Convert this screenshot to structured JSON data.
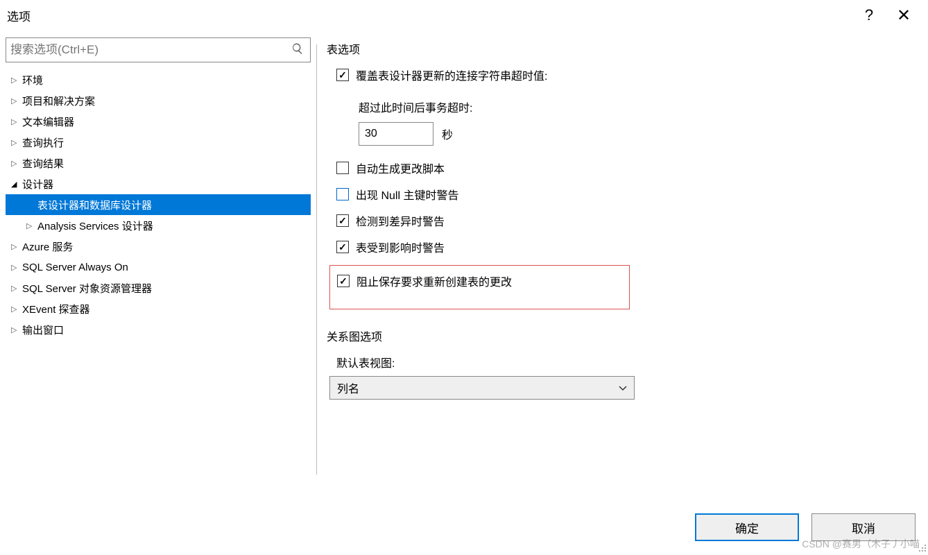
{
  "title": "选项",
  "search": {
    "placeholder": "搜索选项(Ctrl+E)"
  },
  "tree": {
    "items": [
      {
        "label": "环境",
        "level": 1,
        "expanded": false
      },
      {
        "label": "项目和解决方案",
        "level": 1,
        "expanded": false
      },
      {
        "label": "文本编辑器",
        "level": 1,
        "expanded": false
      },
      {
        "label": "查询执行",
        "level": 1,
        "expanded": false
      },
      {
        "label": "查询结果",
        "level": 1,
        "expanded": false
      },
      {
        "label": "设计器",
        "level": 1,
        "expanded": true
      },
      {
        "label": "表设计器和数据库设计器",
        "level": 2,
        "expanded": false,
        "selected": true,
        "leaf": true
      },
      {
        "label": "Analysis Services 设计器",
        "level": 2,
        "expanded": false
      },
      {
        "label": "Azure 服务",
        "level": 1,
        "expanded": false
      },
      {
        "label": "SQL Server Always On",
        "level": 1,
        "expanded": false
      },
      {
        "label": "SQL Server 对象资源管理器",
        "level": 1,
        "expanded": false
      },
      {
        "label": "XEvent 探查器",
        "level": 1,
        "expanded": false
      },
      {
        "label": "输出窗口",
        "level": 1,
        "expanded": false
      }
    ]
  },
  "table_options": {
    "group_title": "表选项",
    "override_timeout": {
      "label": "覆盖表设计器更新的连接字符串超时值",
      "checked": true
    },
    "timeout_label": "超过此时间后事务超时:",
    "timeout_value": "30",
    "timeout_unit": "秒",
    "auto_generate": {
      "label": "自动生成更改脚本",
      "checked": false
    },
    "null_warning": {
      "label": "出现 Null 主键时警告",
      "checked": false,
      "blue": true
    },
    "diff_warning": {
      "label": "检测到差异时警告",
      "checked": true
    },
    "affected_warning": {
      "label": "表受到影响时警告",
      "checked": true
    },
    "prevent_save": {
      "label": "阻止保存要求重新创建表的更改",
      "checked": true
    }
  },
  "diagram_options": {
    "group_title": "关系图选项",
    "default_view_label": "默认表视图:",
    "selected": "列名"
  },
  "buttons": {
    "ok": "确定",
    "cancel": "取消"
  },
  "watermark": "CSDN @赛男（木子丿小喵"
}
